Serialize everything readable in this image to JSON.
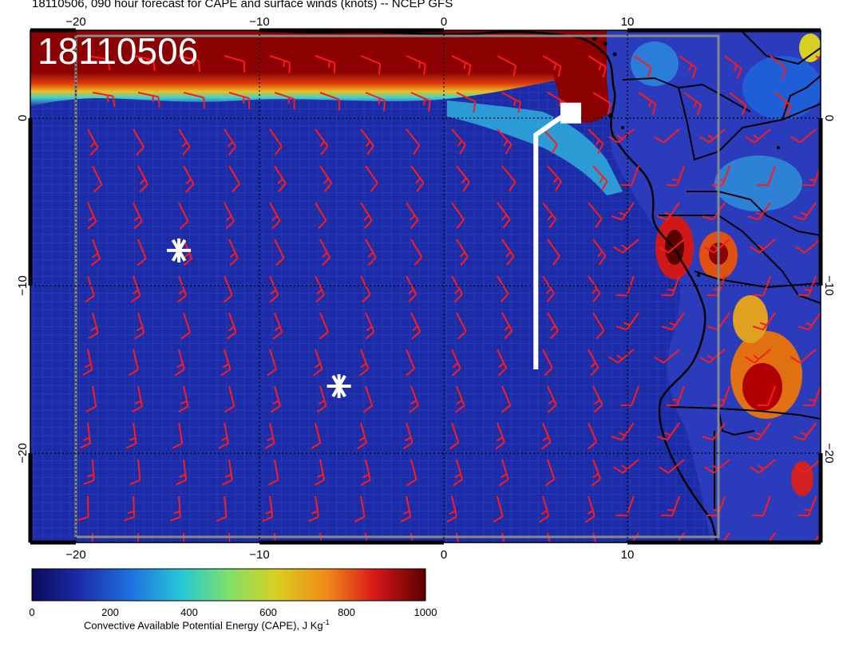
{
  "title": "18110506, 090 hour forecast for CAPE and surface winds (knots) -- NCEP GFS",
  "date_stamp": "18110506",
  "lon_ticks": [
    "−20",
    "−10",
    "0",
    "10"
  ],
  "lat_ticks": [
    "0",
    "−10",
    "−20"
  ],
  "colorbar": {
    "label": "Convective Available Potential Energy (CAPE), J Kg",
    "label_superscript": "-1",
    "ticks": [
      "0",
      "200",
      "400",
      "600",
      "800",
      "1000"
    ]
  },
  "colors": {
    "background_field": "#1c2ca8",
    "high_cape": "#8b0000",
    "wind_barb": "#ff1a1a",
    "track": "#ffffff",
    "coastline": "#000000"
  },
  "chart_data": {
    "type": "heatmap",
    "title": "18110506, 090 hour forecast for CAPE and surface winds (knots) -- NCEP GFS",
    "x_range_lon": [
      -22.5,
      20.5
    ],
    "y_range_lat": [
      5.0,
      -25.5
    ],
    "colorbar_range": [
      0,
      1000
    ],
    "markers": [
      {
        "label": "asterisk-1",
        "lon": -14.4,
        "lat": -7.9
      },
      {
        "label": "asterisk-2",
        "lon": -5.7,
        "lat": -16.0
      }
    ],
    "track": [
      {
        "lon": 5.0,
        "lat": -15.0
      },
      {
        "lon": 5.0,
        "lat": -1.0
      },
      {
        "lon": 6.3,
        "lat": 0.0
      },
      {
        "lon": 6.9,
        "lat": 0.3
      }
    ],
    "track_end_marker_lon_lat": [
      6.9,
      0.3
    ]
  }
}
